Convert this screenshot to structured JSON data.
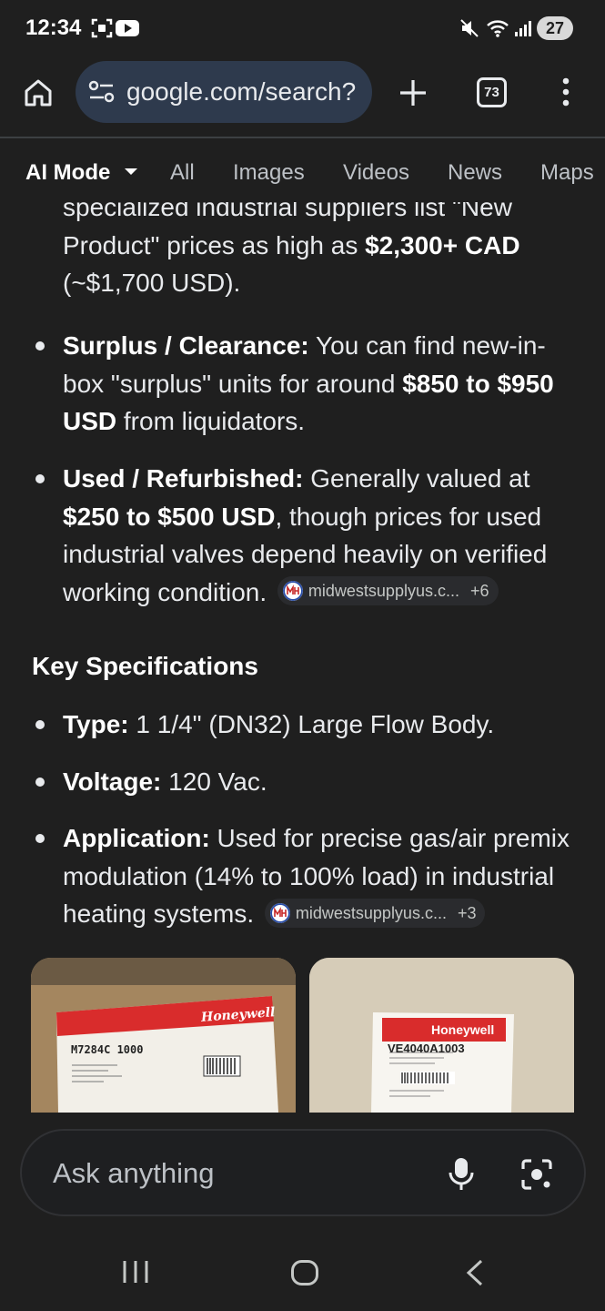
{
  "status_bar": {
    "time": "12:34",
    "battery": "27",
    "icons": [
      "screenshot-icon",
      "youtube-icon",
      "mute-icon",
      "wifi-icon",
      "signal-icon"
    ]
  },
  "toolbar": {
    "url": "google.com/search?",
    "tab_count": "73",
    "icons": [
      "home-icon",
      "site-settings-icon",
      "new-tab-icon",
      "menu-icon"
    ]
  },
  "mode_tabs": [
    {
      "label": "AI Mode",
      "active": true
    },
    {
      "label": "All"
    },
    {
      "label": "Images"
    },
    {
      "label": "Videos"
    },
    {
      "label": "News"
    },
    {
      "label": "Maps"
    }
  ],
  "answer": {
    "partial_top": {
      "line1": "specialized industrial suppliers list \"New",
      "line2_pre": "Product\" prices as high as ",
      "line2_bold": "$2,300+ CAD",
      "line3": "(~$1,700 USD)."
    },
    "surplus": {
      "label": "Surplus / Clearance:",
      "text1": " You can find new-in-",
      "text2": "box \"surplus\" units for around ",
      "bold2": "$850 to $950",
      "bold3": "USD",
      "text3": " from liquidators."
    },
    "used": {
      "label": "Used / Refurbished:",
      "text1": " Generally valued at",
      "bold2": "$250 to $500 USD",
      "text2": ", though prices for used",
      "text3": "industrial valves depend heavily on verified",
      "text4": "working condition.",
      "cite_source": "midwestsupplyus.c...",
      "cite_count": "+6"
    },
    "spec_heading": "Key Specifications",
    "type": {
      "label": "Type:",
      "text": " 1 1/4\" (DN32) Large Flow Body."
    },
    "voltage": {
      "label": "Voltage:",
      "text": " 120 Vac."
    },
    "application": {
      "label": "Application:",
      "text1": " Used for precise gas/air premix",
      "text2": "modulation (14% to 100% load) in industrial",
      "text3": "heating systems.",
      "cite_source": "midwestsupplyus.c...",
      "cite_count": "+3"
    }
  },
  "images": [
    {
      "brand": "Honeywell",
      "model": "M7284C 1000",
      "bg": "#a88a66"
    },
    {
      "brand": "Honeywell",
      "model": "VE4040A1003",
      "bg": "#d8cfbc"
    }
  ],
  "ask_bar": {
    "placeholder": "Ask anything",
    "icons": [
      "mic-icon",
      "lens-icon"
    ]
  },
  "nav_bar": {
    "icons": [
      "recents-icon",
      "home-nav-icon",
      "back-icon"
    ]
  }
}
